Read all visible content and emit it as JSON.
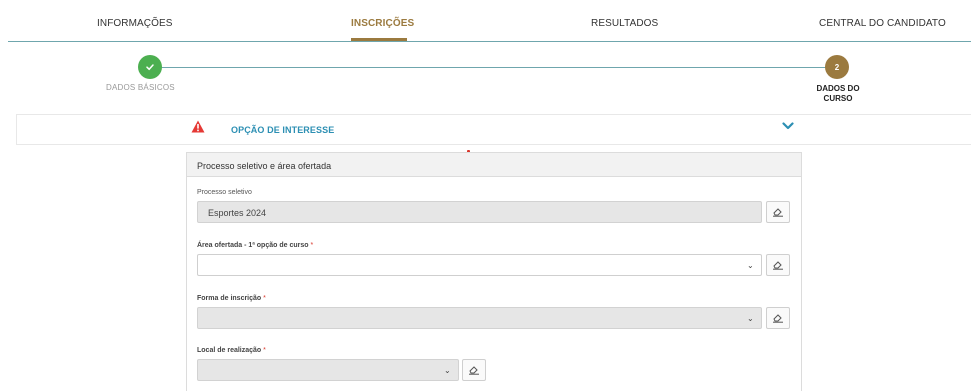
{
  "nav": {
    "items": [
      {
        "label": "INFORMAÇÕES"
      },
      {
        "label": "INSCRIÇÕES"
      },
      {
        "label": "RESULTADOS"
      },
      {
        "label": "CENTRAL DO CANDIDATO"
      }
    ],
    "active_index": 1
  },
  "stepper": {
    "step1": {
      "icon": "check-icon",
      "label": "DADOS BÁSICOS",
      "status": "complete"
    },
    "step2": {
      "number": "2",
      "label": "DADOS DO CURSO",
      "status": "current"
    }
  },
  "section": {
    "title": "OPÇÃO DE INTERESSE",
    "warning_icon": "warning-icon",
    "toggle_icon": "chevron-down-icon"
  },
  "panel": {
    "title": "Processo seletivo e área ofertada",
    "fields": {
      "processo": {
        "label": "Processo seletivo",
        "value": "Esportes 2024"
      },
      "area": {
        "label": "Área ofertada - 1ª opção de curso",
        "required_mark": "*",
        "value": ""
      },
      "forma": {
        "label": "Forma de inscrição",
        "required_mark": "*",
        "value": ""
      },
      "local": {
        "label": "Local de realização",
        "required_mark": "*",
        "value": ""
      }
    }
  },
  "colors": {
    "accent": "#9b7a3f",
    "rule": "#6fa6ad",
    "success": "#4caf50",
    "warning": "#e53935",
    "link": "#2c8fb3"
  }
}
